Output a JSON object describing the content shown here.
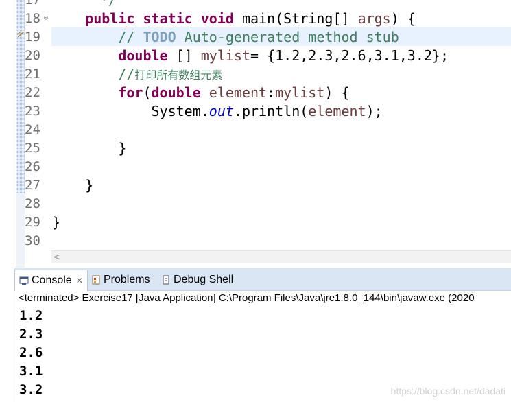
{
  "editor": {
    "line_numbers": [
      "17",
      "18",
      "19",
      "20",
      "21",
      "22",
      "23",
      "24",
      "25",
      "26",
      "27",
      "28",
      "29",
      "30"
    ],
    "top_fragment": "*/",
    "lines": {
      "l18": {
        "indent": "    ",
        "kw1": "public",
        "kw2": "static",
        "kw3": "void",
        "rest1": " main(String[] ",
        "var": "args",
        "rest2": ") {"
      },
      "l19": {
        "indent": "        ",
        "comment_start": "// ",
        "todo": "TODO",
        "comment_rest": " Auto-generated method stub"
      },
      "l20": {
        "indent": "        ",
        "kw": "double",
        "rest1": " [] ",
        "var": "mylist",
        "rest2": "= {1.2,2.3,2.6,3.1,3.2};"
      },
      "l21": {
        "indent": "        ",
        "comment_start": "//",
        "comment_cjk": "打印所有数组元素"
      },
      "l22": {
        "indent": "        ",
        "kw1": "for",
        "p1": "(",
        "kw2": "double",
        "sp": " ",
        "var1": "element",
        "colon": ":",
        "var2": "mylist",
        "rest": ") {"
      },
      "l23": {
        "indent": "            ",
        "cls": "System.",
        "fld": "out",
        "call": ".println(",
        "var": "element",
        "end": ");"
      },
      "l25": {
        "text": "        }"
      },
      "l27": {
        "text": "    }"
      },
      "l29": {
        "text": "}"
      }
    },
    "scroll_left_glyph": "<"
  },
  "console": {
    "tabs": [
      {
        "label": "Console",
        "active": true,
        "close": "✕"
      },
      {
        "label": "Problems"
      },
      {
        "label": "Debug Shell"
      }
    ],
    "status": "<terminated> Exercise17 [Java Application] C:\\Program Files\\Java\\jre1.8.0_144\\bin\\javaw.exe (2020",
    "output": [
      "1.2",
      "2.3",
      "2.6",
      "3.1",
      "3.2"
    ]
  },
  "watermark": "https://blog.csdn.net/dadati",
  "colors": {
    "keyword": "#7f0055",
    "comment": "#3f7f5f",
    "todo": "#7f9fbf",
    "variable": "#6a3e3e",
    "field": "#0000c0",
    "current_line": "#e8f2fe",
    "tab_bar": "#dbe6f4"
  }
}
